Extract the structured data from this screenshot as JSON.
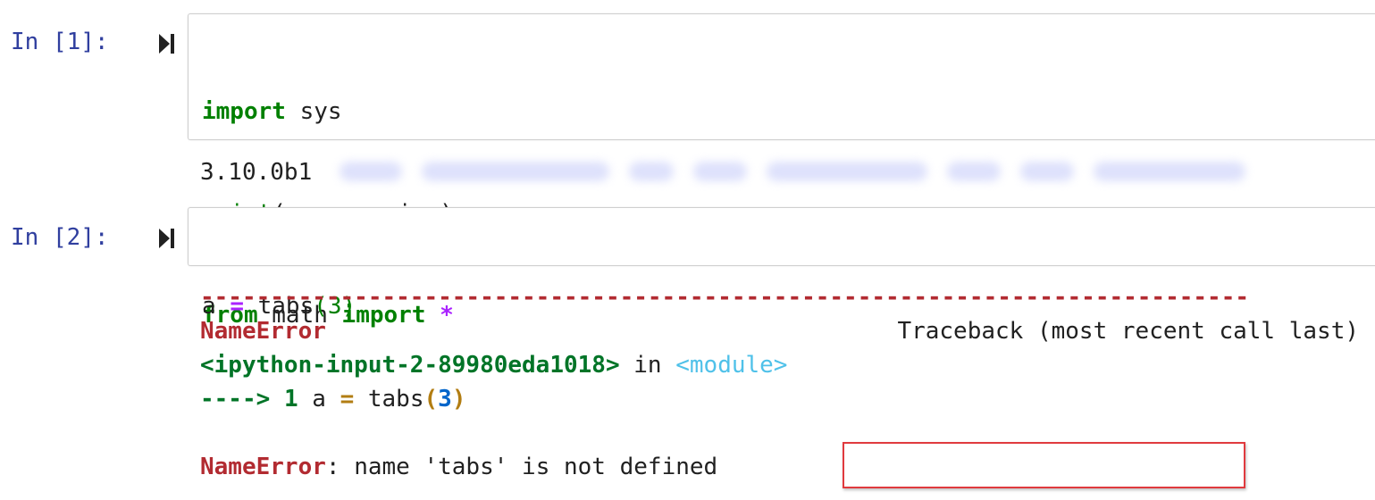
{
  "cells": [
    {
      "prompt": "In [1]:",
      "code_lines": [
        [
          "import",
          " sys"
        ],
        [
          "print",
          "(sys.version)"
        ],
        [
          "from",
          " math ",
          "import",
          " *"
        ]
      ],
      "output": "3.10.0b1"
    },
    {
      "prompt": "In [2]:",
      "code": {
        "var": "a",
        "eq": "=",
        "func": " tabs",
        "open": "(",
        "arg": "3",
        "close": ")"
      },
      "error": {
        "dashes": "---------------------------------------------------------------------------",
        "name": "NameError",
        "traceback_label": "Traceback (most recent call last)",
        "source": "<ipython-input-2-89980eda1018>",
        "in_word": " in ",
        "module": "<module>",
        "arrow": "---->",
        "lineno": "1",
        "line_var": "a",
        "line_eq": "=",
        "line_func": "tabs",
        "line_open": "(",
        "line_arg": "3",
        "line_close": ")",
        "final_name": "NameError",
        "final_msg": ": name 'tabs' is not defined"
      }
    }
  ],
  "colors": {
    "prompt": "#303f9f",
    "keyword": "#008000",
    "operator": "#aa22ff",
    "error_red": "#b22b31",
    "highlight_box": "#e03a3e"
  },
  "icons": {
    "run": "step-forward-icon"
  }
}
